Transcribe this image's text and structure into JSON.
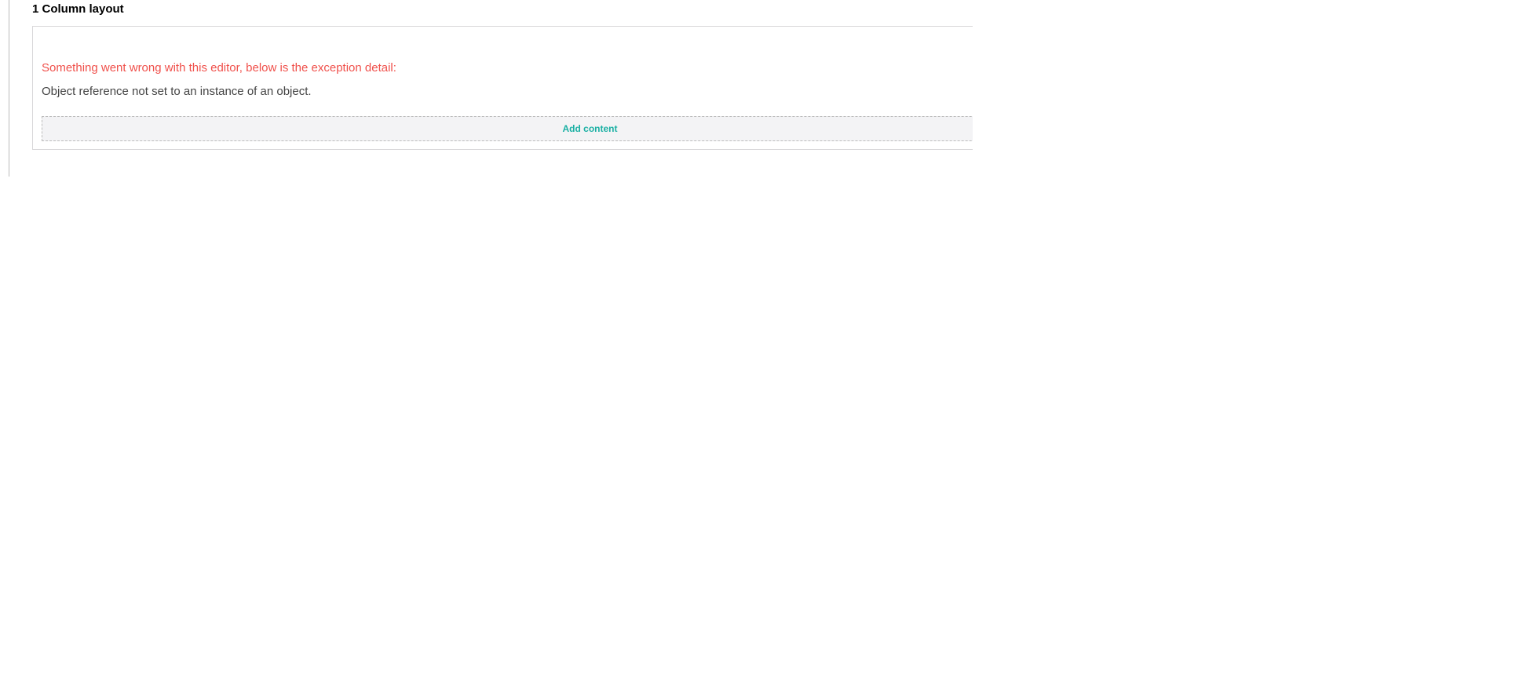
{
  "layout": {
    "title": "1 Column layout"
  },
  "editor": {
    "error_heading": "Something went wrong with this editor, below is the exception detail:",
    "error_detail": "Object reference not set to an instance of an object.",
    "add_content_label": "Add content"
  },
  "colors": {
    "error": "#f0504b",
    "accent": "#1bb0a4",
    "border": "#d8d7d9"
  }
}
